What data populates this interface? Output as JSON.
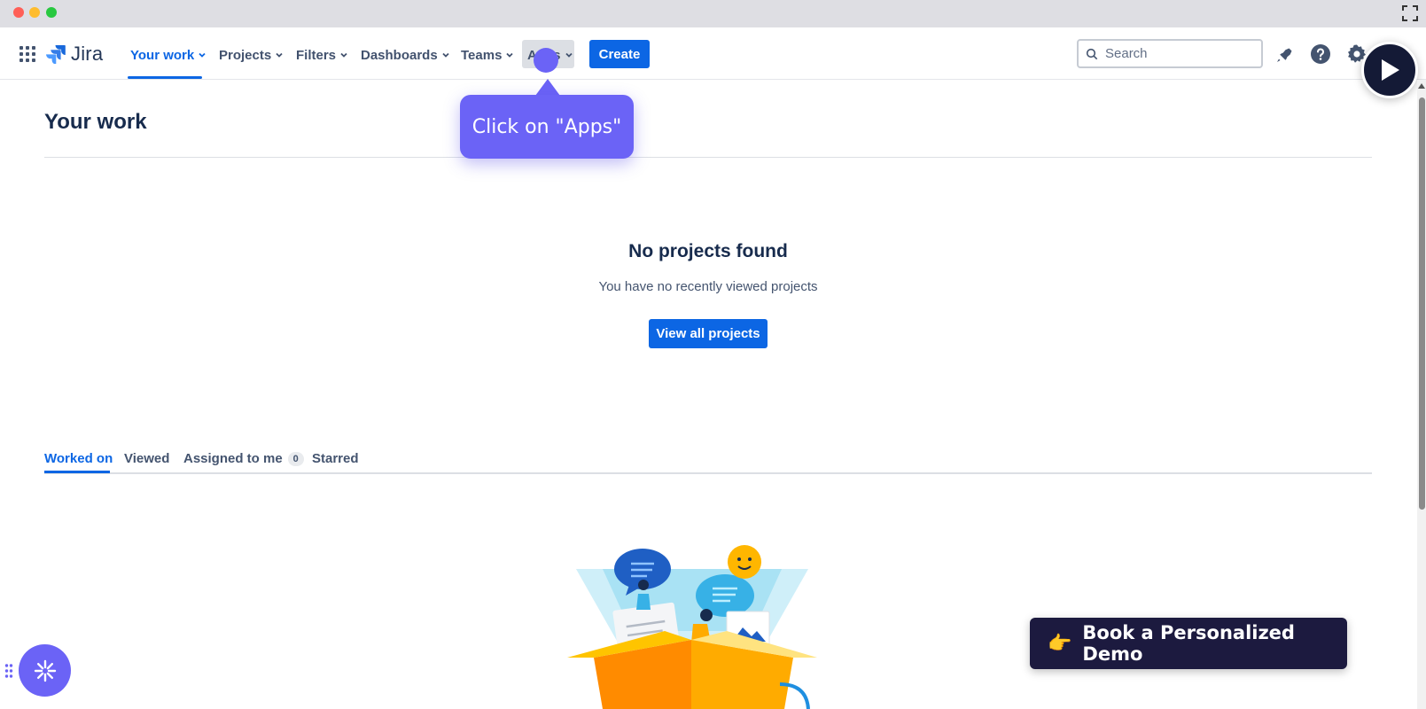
{
  "app": {
    "name": "Jira"
  },
  "nav": {
    "items": [
      {
        "label": "Your work",
        "active": true
      },
      {
        "label": "Projects"
      },
      {
        "label": "Filters"
      },
      {
        "label": "Dashboards"
      },
      {
        "label": "Teams"
      },
      {
        "label": "Apps"
      }
    ],
    "create_label": "Create",
    "search_placeholder": "Search",
    "icons": [
      "notification-icon",
      "help-icon",
      "settings-icon"
    ]
  },
  "page": {
    "title": "Your work"
  },
  "empty_state": {
    "title": "No projects found",
    "subtitle": "You have no recently viewed projects",
    "button_label": "View all projects"
  },
  "tabs": [
    {
      "label": "Worked on",
      "active": true
    },
    {
      "label": "Viewed"
    },
    {
      "label": "Assigned to me",
      "count": "0"
    },
    {
      "label": "Starred"
    }
  ],
  "guide": {
    "tooltip": "Click on \"Apps\""
  },
  "demo_button": {
    "emoji": "👉",
    "label": "Book a Personalized Demo"
  },
  "colors": {
    "accent": "#0c66e4",
    "guide": "#6b63f6",
    "demo_bg": "#1c1a3f"
  }
}
